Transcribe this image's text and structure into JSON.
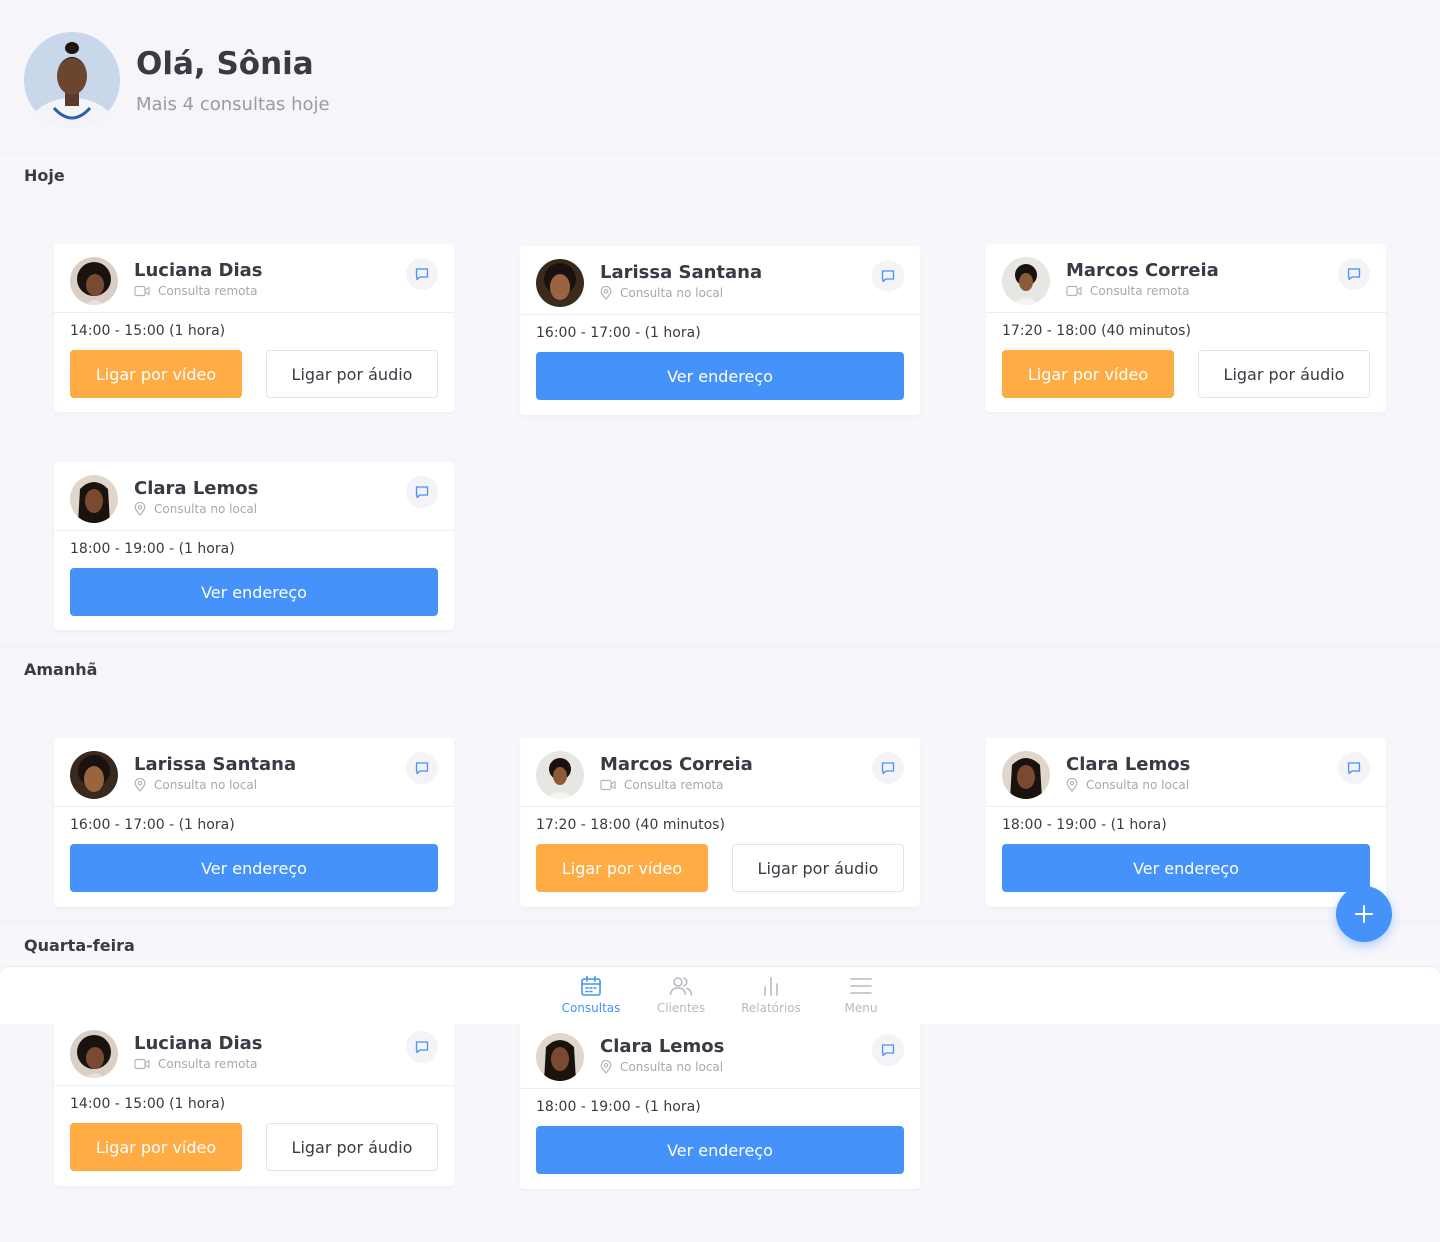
{
  "header": {
    "greeting": "Olá, Sônia",
    "subtitle": "Mais 4 consultas hoje"
  },
  "sections": [
    {
      "title": "Hoje",
      "cards": [
        {
          "name": "Luciana Dias",
          "type": "Consulta remota",
          "time": "14:00 - 15:00 (1 hora)",
          "video": "Ligar por vídeo",
          "audio": "Ligar por áudio"
        },
        {
          "name": "Larissa Santana",
          "type": "Consulta no local",
          "time": "16:00 - 17:00 - (1 hora)",
          "address": "Ver endereço"
        },
        {
          "name": "Marcos Correia",
          "type": "Consulta remota",
          "time": "17:20 - 18:00 (40 minutos)",
          "video": "Ligar por vídeo",
          "audio": "Ligar por áudio"
        },
        {
          "name": "Clara Lemos",
          "type": "Consulta no local",
          "time": "18:00 - 19:00 - (1 hora)",
          "address": "Ver endereço"
        }
      ]
    },
    {
      "title": "Amanhã",
      "cards": [
        {
          "name": "Larissa Santana",
          "type": "Consulta no local",
          "time": "16:00 - 17:00 - (1 hora)",
          "address": "Ver endereço"
        },
        {
          "name": "Marcos Correia",
          "type": "Consulta remota",
          "time": "17:20 - 18:00 (40 minutos)",
          "video": "Ligar por vídeo",
          "audio": "Ligar por áudio"
        },
        {
          "name": "Clara Lemos",
          "type": "Consulta no local",
          "time": "18:00 - 19:00 - (1 hora)",
          "address": "Ver endereço"
        }
      ]
    },
    {
      "title": "Quarta-feira",
      "cards": [
        {
          "name": "Luciana Dias",
          "type": "Consulta remota",
          "time": "14:00 - 15:00 (1 hora)",
          "video": "Ligar por vídeo",
          "audio": "Ligar por áudio"
        },
        {
          "name": "Clara Lemos",
          "type": "Consulta no local",
          "time": "18:00 - 19:00 - (1 hora)",
          "address": "Ver endereço"
        }
      ]
    }
  ],
  "nav": [
    {
      "label": "Consultas",
      "icon": "calendar-icon",
      "active": true
    },
    {
      "label": "Clientes",
      "icon": "users-icon",
      "active": false
    },
    {
      "label": "Relatórios",
      "icon": "bar-chart-icon",
      "active": false
    },
    {
      "label": "Menu",
      "icon": "menu-icon",
      "active": false
    }
  ],
  "fab": {
    "icon": "plus-icon"
  },
  "colors": {
    "primary": "#4592fa",
    "video": "#ffac45"
  }
}
